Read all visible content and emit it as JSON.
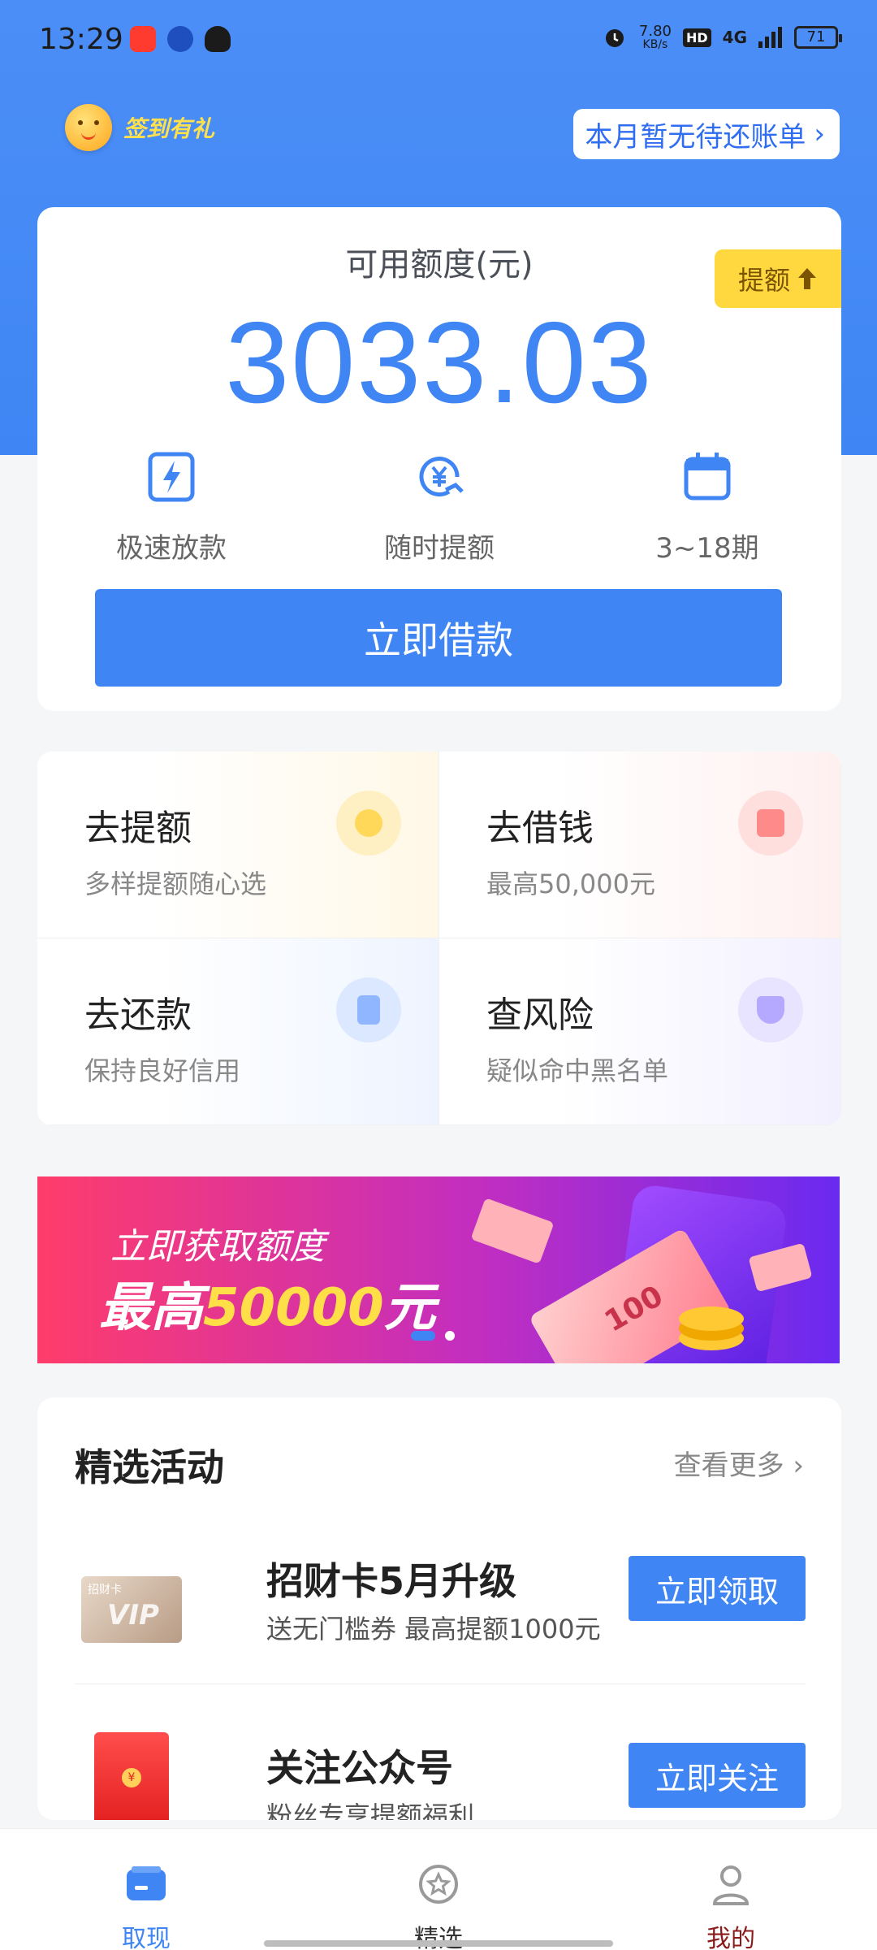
{
  "status_bar": {
    "time": "13:29",
    "net_speed": "7.80",
    "net_unit": "KB/s",
    "hd": "HD",
    "net_type": "4G",
    "battery": "71"
  },
  "header": {
    "checkin_label": "签到有礼",
    "bill_notice": "本月暂无待还账单"
  },
  "credit": {
    "label": "可用额度(元)",
    "amount": "3033.03",
    "raise_label": "提额",
    "features": [
      {
        "label": "极速放款",
        "icon": "lightning-icon"
      },
      {
        "label": "随时提额",
        "icon": "yen-refresh-icon"
      },
      {
        "label": "3~18期",
        "icon": "calendar-icon"
      }
    ],
    "borrow_button": "立即借款"
  },
  "quick_actions": [
    {
      "title": "去提额",
      "sub": "多样提额随心选",
      "icon": "raise-icon",
      "color": "#ffd85a"
    },
    {
      "title": "去借钱",
      "sub": "最高50,000元",
      "icon": "wallet-icon",
      "color": "#ff8a8a"
    },
    {
      "title": "去还款",
      "sub": "保持良好信用",
      "icon": "bill-icon",
      "color": "#8fb6ff"
    },
    {
      "title": "查风险",
      "sub": "疑似命中黑名单",
      "icon": "shield-icon",
      "color": "#b5a8ff"
    }
  ],
  "banner": {
    "line1": "立即获取额度",
    "line2_prefix": "最高",
    "line2_amount": "50000",
    "line2_suffix": "元",
    "money_note": "100"
  },
  "activities": {
    "title": "精选活动",
    "more": "查看更多",
    "items": [
      {
        "title": "招财卡5月升级",
        "sub": "送无门槛券  最高提额1000元",
        "button": "立即领取",
        "thumb_text": "招财卡"
      },
      {
        "title": "关注公众号",
        "sub": "粉丝专享提额福利",
        "button": "立即关注",
        "thumb_text": "¥"
      }
    ]
  },
  "bottom_nav": [
    {
      "label": "取现",
      "active": true
    },
    {
      "label": "精选",
      "active": false
    },
    {
      "label": "我的",
      "active": false
    }
  ],
  "colors": {
    "primary": "#3f86f4",
    "raise_tag": "#ffd83f",
    "checkin_text": "#ffe14d"
  }
}
